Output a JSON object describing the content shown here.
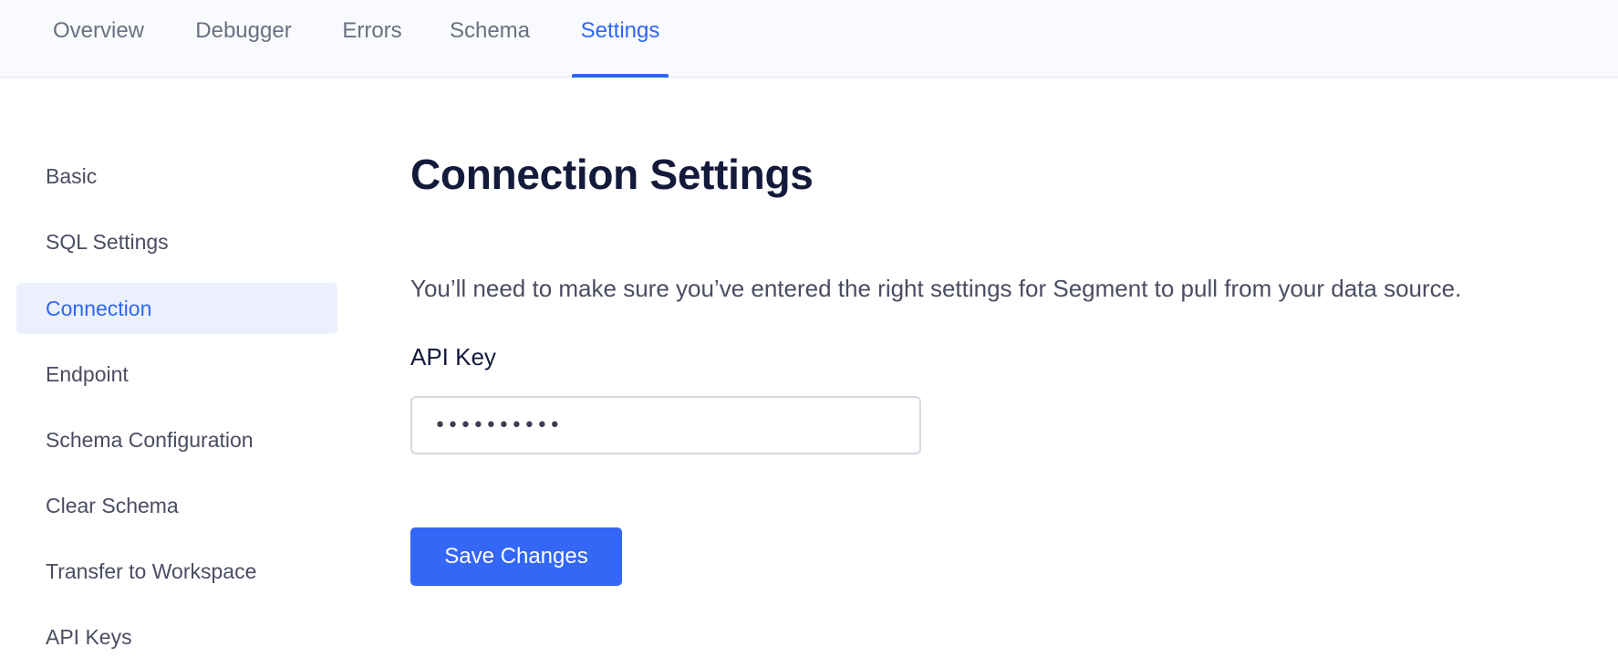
{
  "nav": {
    "tabs": [
      {
        "label": "Overview"
      },
      {
        "label": "Debugger"
      },
      {
        "label": "Errors"
      },
      {
        "label": "Schema"
      },
      {
        "label": "Settings"
      }
    ],
    "active_tab": "Settings"
  },
  "sidebar": {
    "items": [
      {
        "label": "Basic"
      },
      {
        "label": "SQL Settings"
      },
      {
        "label": "Connection"
      },
      {
        "label": "Endpoint"
      },
      {
        "label": "Schema Configuration"
      },
      {
        "label": "Clear Schema"
      },
      {
        "label": "Transfer to Workspace"
      },
      {
        "label": "API Keys"
      }
    ],
    "active_item": "Connection"
  },
  "main": {
    "title": "Connection Settings",
    "description": "You’ll need to make sure you’ve entered the right settings for Segment to pull from your data source.",
    "api_key": {
      "label": "API Key",
      "value": "••••••••••"
    },
    "save_label": "Save Changes"
  },
  "colors": {
    "accent": "#2f67f5",
    "button": "#3467f6",
    "active_bg": "#ebf0fc",
    "heading": "#141a3a"
  }
}
